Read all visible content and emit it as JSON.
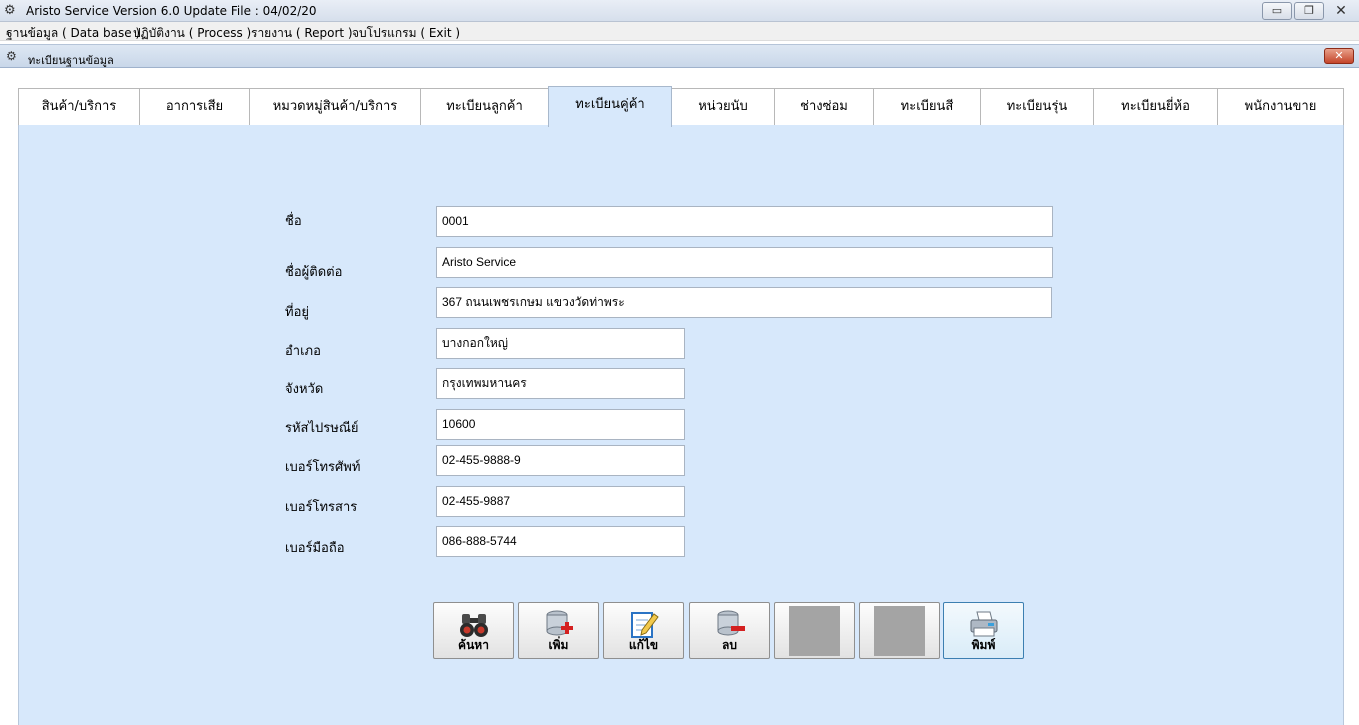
{
  "window": {
    "title": "Aristo Service Version 6.0 Update File : 04/02/20",
    "min_glyph": "▭",
    "max_glyph": "❐",
    "close_glyph": "✕"
  },
  "menu": [
    "ฐานข้อมูล ( Data base )",
    "ปฏิบัติงาน ( Process )",
    "รายงาน ( Report )",
    "จบโปรแกรม ( Exit )"
  ],
  "child_window": {
    "title": "ทะเบียนฐานข้อมูล",
    "close_glyph": "✕"
  },
  "tabs": [
    "สินค้า/บริการ",
    "อาการเสีย",
    "หมวดหมู่สินค้า/บริการ",
    "ทะเบียนลูกค้า",
    "ทะเบียนคู่ค้า",
    "หน่วยนับ",
    "ช่างซ่อม",
    "ทะเบียนสี",
    "ทะเบียนรุ่น",
    "ทะเบียนยี่ห้อ",
    "พนักงานขาย"
  ],
  "active_tab": "ทะเบียนคู่ค้า",
  "form": {
    "name": {
      "label": "ชื่อ",
      "value": "0001"
    },
    "contact": {
      "label": "ชื่อผู้ติดต่อ",
      "value": "Aristo Service"
    },
    "address": {
      "label": "ที่อยู่",
      "value": "367 ถนนเพชรเกษม แขวงวัดท่าพระ"
    },
    "district": {
      "label": "อำเภอ",
      "value": "บางกอกใหญ่"
    },
    "province": {
      "label": "จังหวัด",
      "value": "กรุงเทพมหานคร"
    },
    "postcode": {
      "label": "รหัสไปรษณีย์",
      "value": "10600"
    },
    "phone": {
      "label": "เบอร์โทรศัพท์",
      "value": "02-455-9888-9"
    },
    "fax": {
      "label": "เบอร์โทรสาร",
      "value": "02-455-9887"
    },
    "mobile": {
      "label": "เบอร์มือถือ",
      "value": "086-888-5744"
    }
  },
  "buttons": {
    "search": "ค้นหา",
    "add": "เพิ่ม",
    "edit": "แก้ไข",
    "delete": "ลบ",
    "print": "พิมพ์"
  }
}
